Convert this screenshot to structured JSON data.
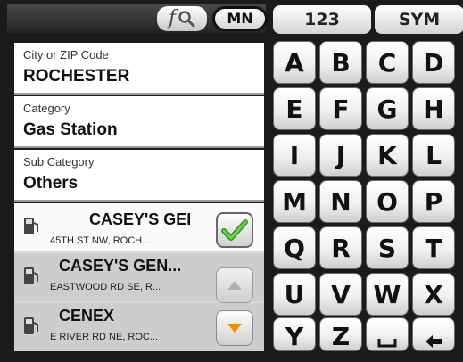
{
  "toolbar": {
    "search_label": "f",
    "state_label": "MN"
  },
  "form": {
    "city": {
      "label": "City or ZIP Code",
      "value": "ROCHESTER"
    },
    "category": {
      "label": "Category",
      "value": "Gas Station"
    },
    "sub_category": {
      "label": "Sub Category",
      "value": "Others"
    }
  },
  "results": [
    {
      "name": "CASEY'S GEI",
      "address": "45TH ST NW, ROCH..."
    },
    {
      "name": "CASEY'S GEN...",
      "address": "EASTWOOD RD SE, R..."
    },
    {
      "name": "CENEX",
      "address": "E RIVER RD NE, ROC..."
    }
  ],
  "keyboard": {
    "mode_keys": [
      "123",
      "SYM"
    ],
    "rows": [
      [
        "A",
        "B",
        "C",
        "D"
      ],
      [
        "E",
        "F",
        "G",
        "H"
      ],
      [
        "I",
        "J",
        "K",
        "L"
      ],
      [
        "M",
        "N",
        "O",
        "P"
      ],
      [
        "Q",
        "R",
        "S",
        "T"
      ],
      [
        "U",
        "V",
        "W",
        "X"
      ],
      [
        "Y",
        "Z"
      ]
    ],
    "special_keys": [
      "space-icon",
      "backspace-arrow-icon"
    ]
  },
  "colors": {
    "background": "#1b1b1b",
    "check_green": "#3aa62e",
    "down_arrow_orange": "#f08c00"
  }
}
